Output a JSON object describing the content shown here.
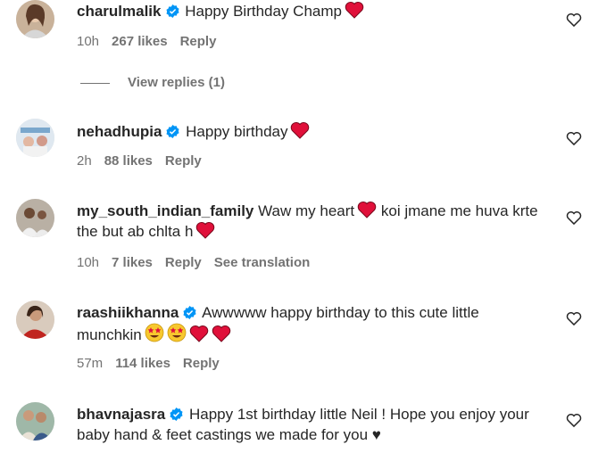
{
  "comments": [
    {
      "username": "charulmalik",
      "verified": true,
      "text": "Happy Birthday Champ",
      "emojis": [
        "red-heart"
      ],
      "time": "10h",
      "likes": "267 likes",
      "reply": "Reply",
      "view_replies": "View replies (1)"
    },
    {
      "username": "nehadhupia",
      "verified": true,
      "text": "Happy birthday",
      "emojis": [
        "red-heart"
      ],
      "time": "2h",
      "likes": "88 likes",
      "reply": "Reply"
    },
    {
      "username": "my_south_indian_family",
      "verified": false,
      "text_part1": "Waw my heart",
      "text_part2": " koi jmane me huva krte the but ab chlta h",
      "emojis": [
        "red-heart",
        "red-heart"
      ],
      "time": "10h",
      "likes": "7 likes",
      "reply": "Reply",
      "translation": "See translation"
    },
    {
      "username": "raashiikhanna",
      "verified": true,
      "text": "Awwwww happy birthday to this cute little munchkin",
      "emojis": [
        "star-struck",
        "star-struck",
        "red-heart",
        "red-heart"
      ],
      "time": "57m",
      "likes": "114 likes",
      "reply": "Reply"
    },
    {
      "username": "bhavnajasra",
      "verified": true,
      "text": "Happy 1st birthday little Neil ! Hope you enjoy your baby hand & feet castings we made for you ♥",
      "emojis": [],
      "time": "",
      "likes": "",
      "reply": ""
    }
  ],
  "colors": {
    "verified": "#0095f6",
    "heart": "#e0103a",
    "meta": "#737373"
  }
}
